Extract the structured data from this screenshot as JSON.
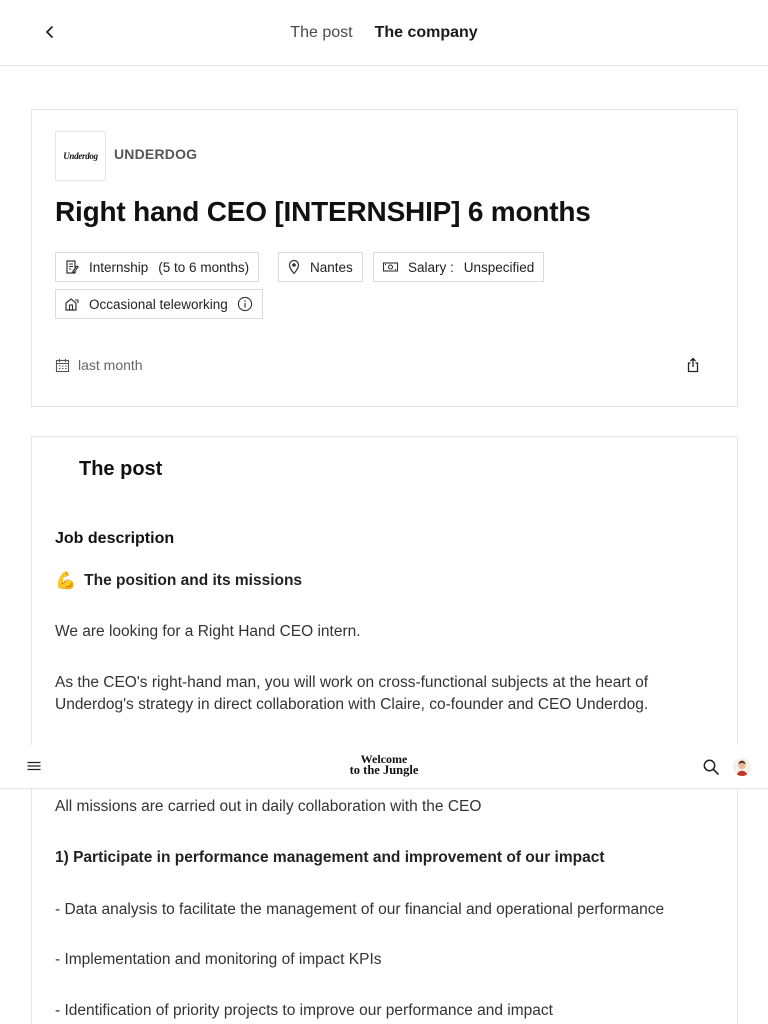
{
  "header": {
    "tabs": [
      {
        "label": "The post",
        "active": false
      },
      {
        "label": "The company",
        "active": true
      }
    ]
  },
  "company": {
    "logo_text": "Underdog",
    "name": "UNDERDOG"
  },
  "job": {
    "title": "Right hand CEO [INTERNSHIP] 6 months",
    "tags": {
      "contract": "Internship",
      "duration": "(5 to 6 months)",
      "location": "Nantes",
      "salary_label": "Salary :",
      "salary_value": "Unspecified",
      "remote": "Occasional teleworking"
    },
    "posted": "last month"
  },
  "post": {
    "heading": "The post",
    "job_description": "Job description",
    "missions_emoji": "💪",
    "missions_heading": "The position and its missions",
    "paragraphs": [
      "We are looking for a Right Hand CEO intern.",
      "As the CEO's right-hand man, you will work on cross-functional subjects at the heart of Underdog's strategy in direct collaboration with Claire, co-founder and CEO Underdog.",
      "All missions are carried out in daily collaboration with the CEO",
      "1) Participate in performance management and improvement of our impact",
      "- Data analysis to facilitate the management of our financial and operational performance",
      "- Implementation and monitoring of impact KPIs",
      "- Identification of priority projects to improve our performance and impact"
    ]
  },
  "navbar": {
    "brand_line1": "Welcome",
    "brand_line2": "to the Jungle"
  },
  "colors": {
    "border": "#e4e4e4",
    "text": "#1f1f1f",
    "muted": "#666666"
  }
}
